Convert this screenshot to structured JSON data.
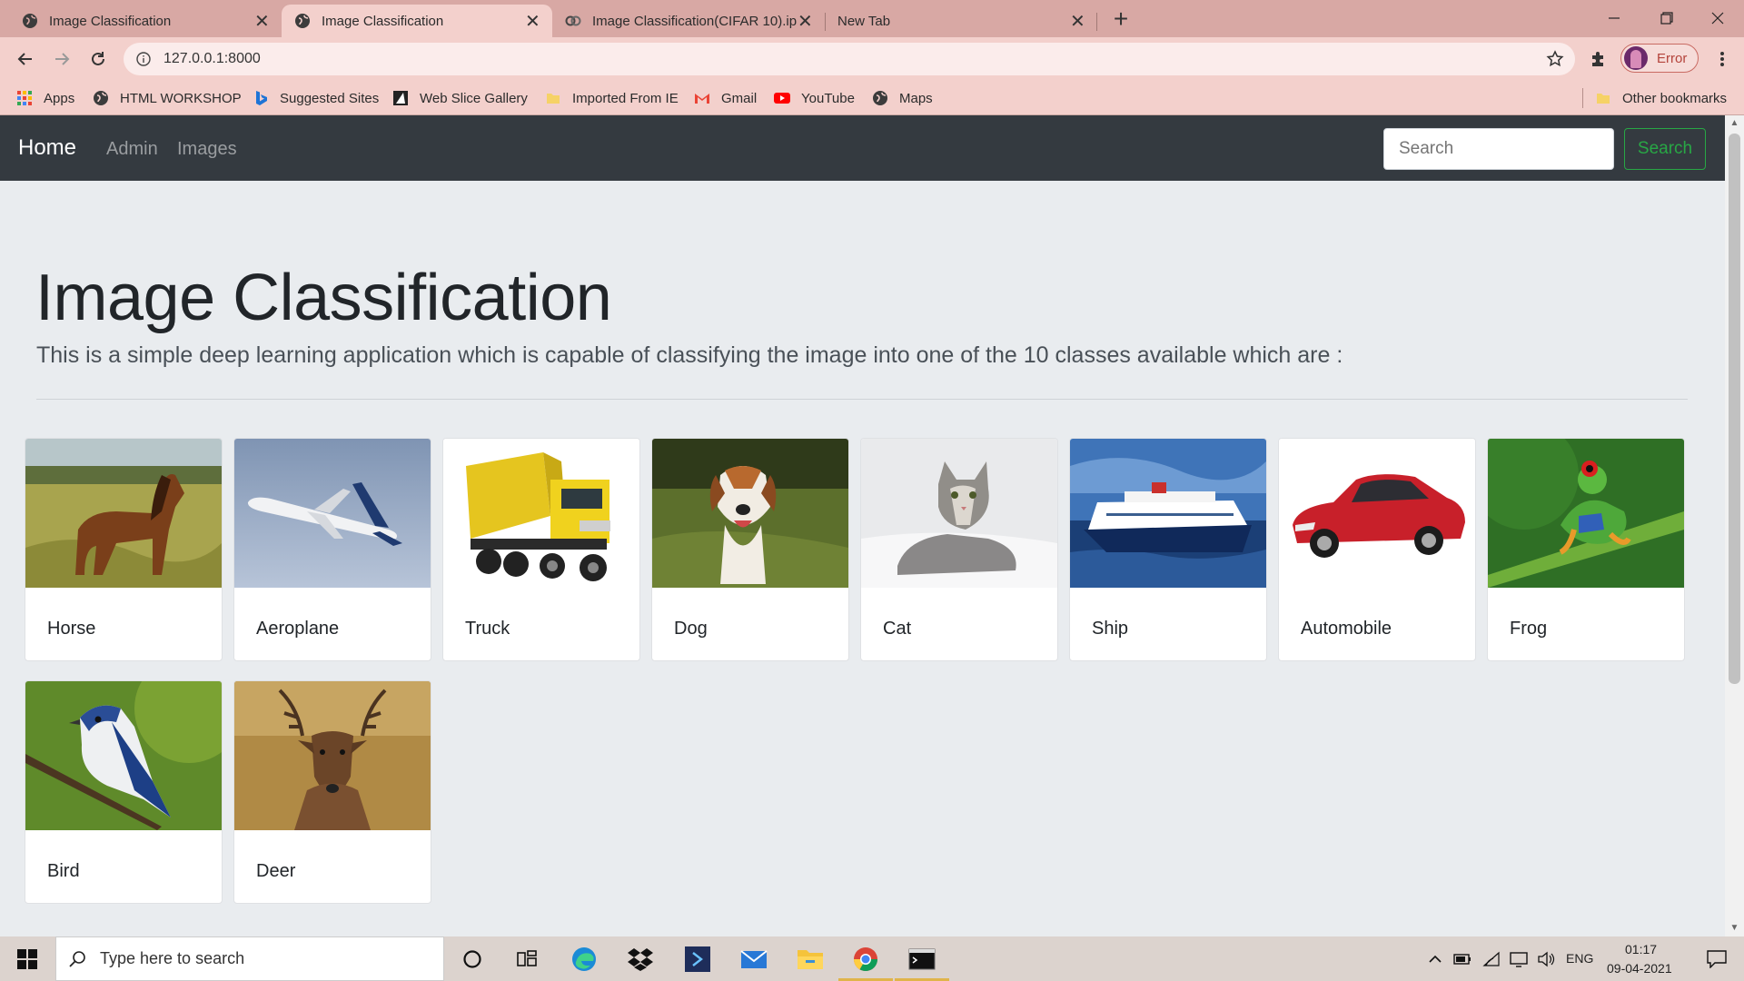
{
  "browser": {
    "tabs": [
      {
        "title": "Image Classification",
        "active": false
      },
      {
        "title": "Image Classification",
        "active": true
      },
      {
        "title": "Image Classification(CIFAR 10).ip",
        "active": false
      },
      {
        "title": "New Tab",
        "active": false
      }
    ],
    "url": "127.0.0.1:8000",
    "profile_label": "Error",
    "bookmarks": [
      "Apps",
      "HTML WORKSHOP",
      "Suggested Sites",
      "Web Slice Gallery",
      "Imported From IE",
      "Gmail",
      "YouTube",
      "Maps"
    ],
    "other_bookmarks": "Other bookmarks"
  },
  "page": {
    "navbar": {
      "brand": "Home",
      "links": [
        "Admin",
        "Images"
      ],
      "search_placeholder": "Search",
      "search_button": "Search"
    },
    "title": "Image Classification",
    "lead": "This is a simple deep learning application which is capable of classifying the image into one of the 10 classes available which are :",
    "classes": [
      {
        "label": "Horse",
        "image": "horse-image"
      },
      {
        "label": "Aeroplane",
        "image": "aeroplane-image"
      },
      {
        "label": "Truck",
        "image": "truck-image"
      },
      {
        "label": "Dog",
        "image": "dog-image"
      },
      {
        "label": "Cat",
        "image": "cat-image"
      },
      {
        "label": "Ship",
        "image": "ship-image"
      },
      {
        "label": "Automobile",
        "image": "automobile-image"
      },
      {
        "label": "Frog",
        "image": "frog-image"
      },
      {
        "label": "Bird",
        "image": "bird-image"
      },
      {
        "label": "Deer",
        "image": "deer-image"
      }
    ]
  },
  "taskbar": {
    "search_placeholder": "Type here to search",
    "language": "ENG",
    "time": "01:17",
    "date": "09-04-2021"
  },
  "colors": {
    "tab_strip": "#d8a8a4",
    "toolbar": "#f3d0cc",
    "navbar": "#343a40",
    "page_bg": "#e9ecef",
    "search_button": "#28a745"
  }
}
